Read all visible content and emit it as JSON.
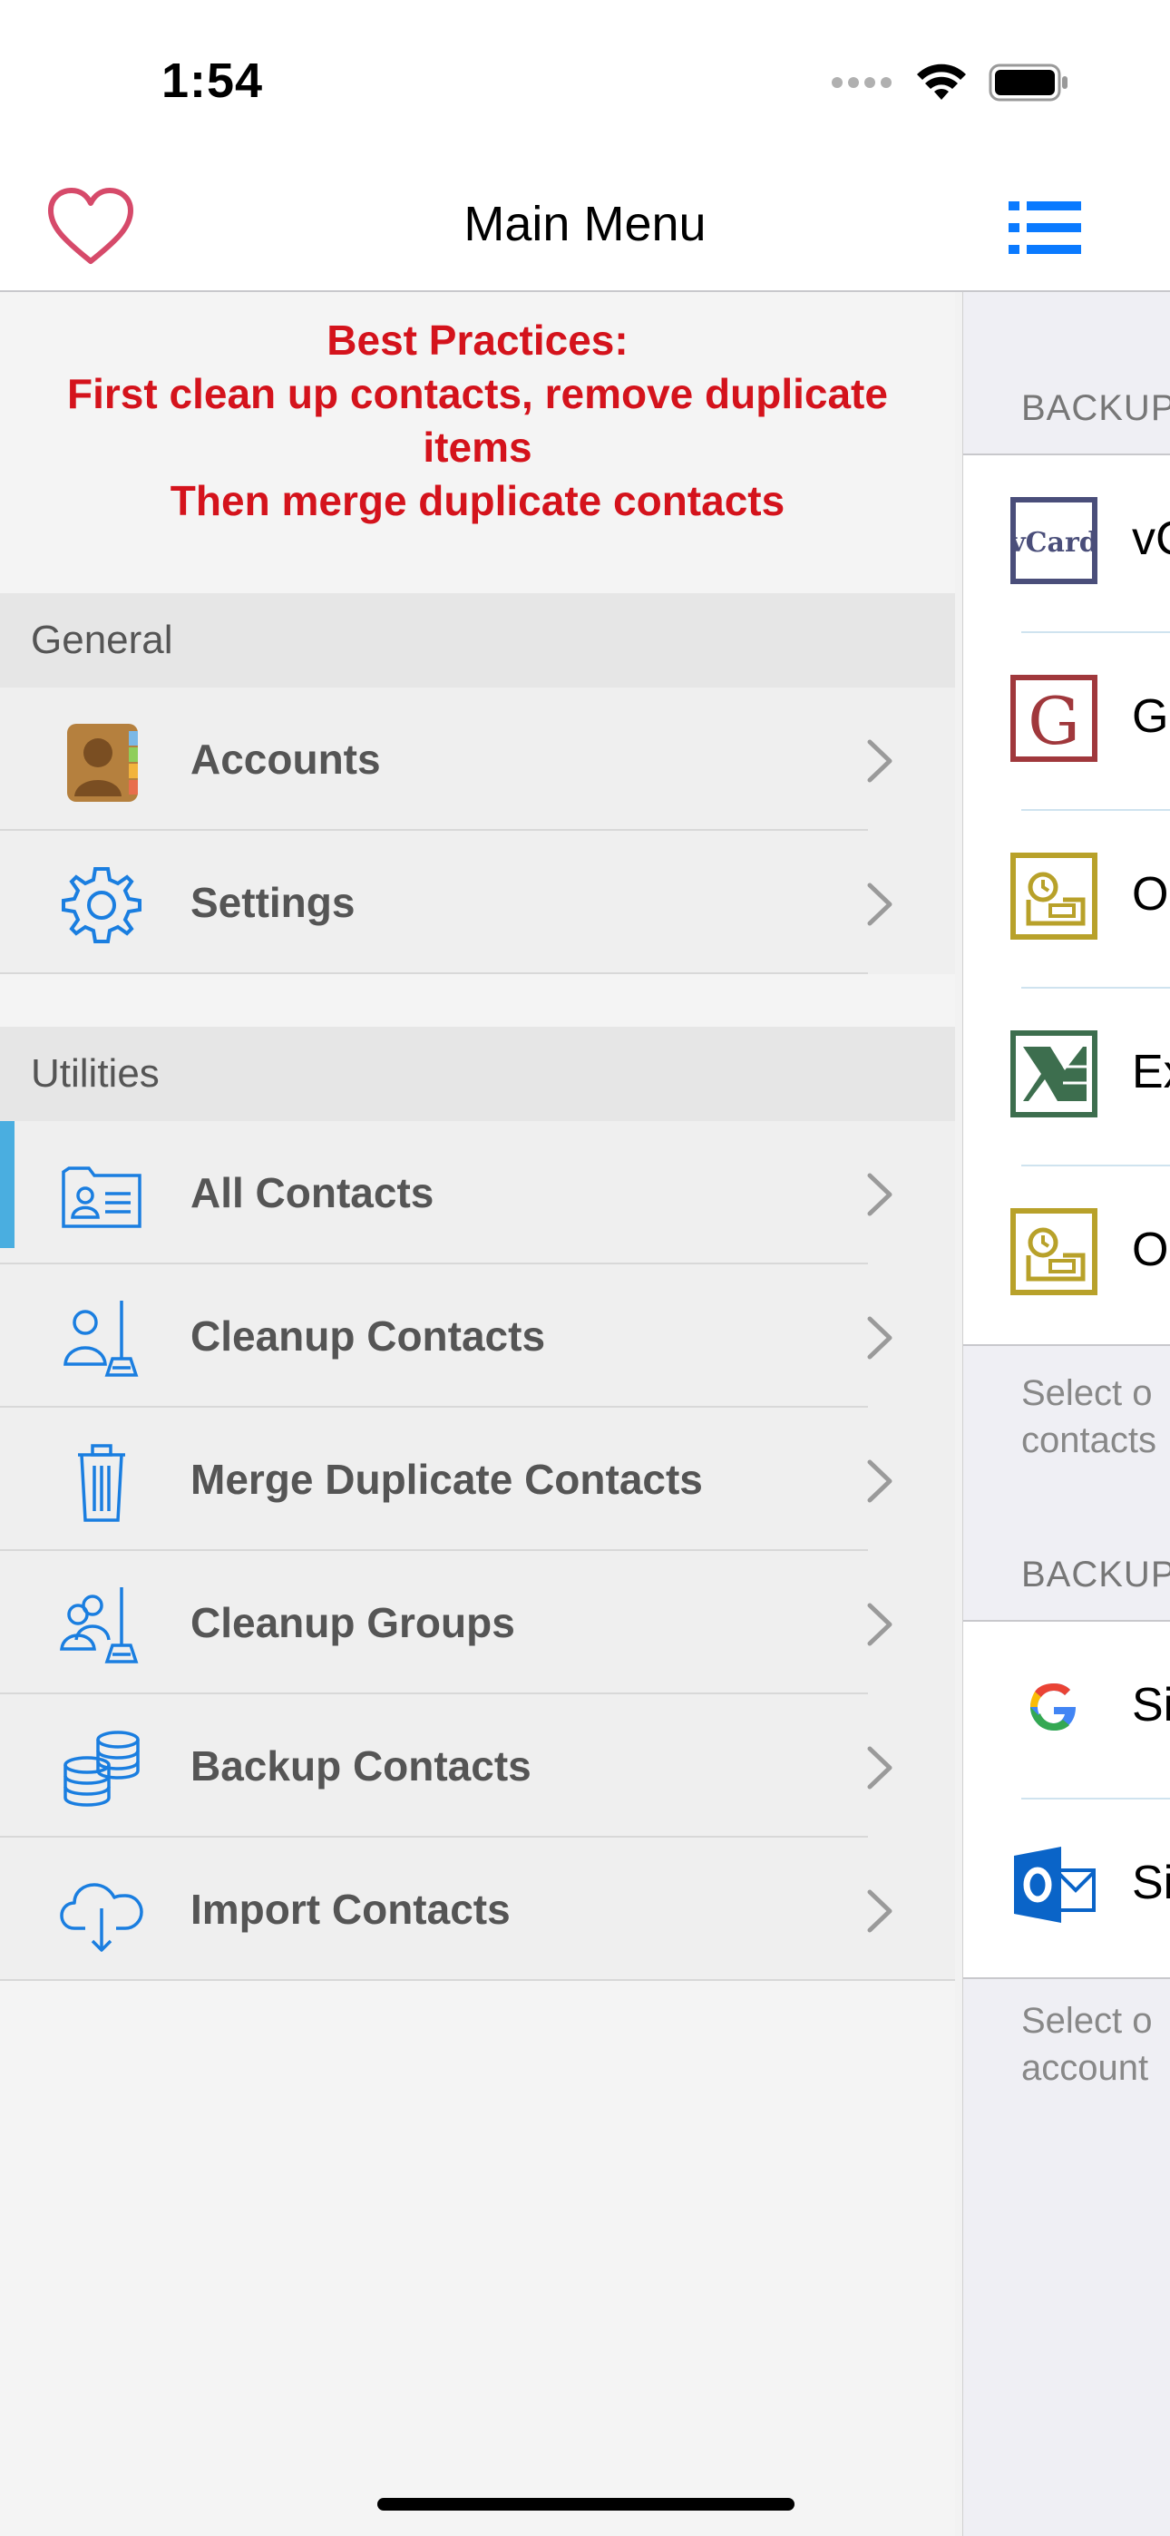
{
  "status_bar": {
    "time": "1:54"
  },
  "nav": {
    "title": "Main Menu",
    "left_icon": "heart-icon",
    "right_icon": "list-icon",
    "accent_color": "#0a7aff",
    "heart_color": "#d64a6a"
  },
  "best_practices": {
    "line1": "Best Practices:",
    "line2": "First clean up contacts, remove duplicate items",
    "line3": "Then merge duplicate contacts",
    "color": "#d4131c"
  },
  "general": {
    "header": "General",
    "items": [
      {
        "label": "Accounts",
        "icon": "contacts-book-icon"
      },
      {
        "label": "Settings",
        "icon": "gear-icon"
      }
    ]
  },
  "utilities": {
    "header": "Utilities",
    "items": [
      {
        "label": "All Contacts",
        "icon": "contact-card-icon"
      },
      {
        "label": "Cleanup Contacts",
        "icon": "cleanup-person-icon"
      },
      {
        "label": "Merge Duplicate Contacts",
        "icon": "trash-icon"
      },
      {
        "label": "Cleanup Groups",
        "icon": "cleanup-group-icon"
      },
      {
        "label": "Backup Contacts",
        "icon": "database-stack-icon"
      },
      {
        "label": "Import Contacts",
        "icon": "cloud-download-icon"
      }
    ]
  },
  "right_panel": {
    "section1_header": "BACKUP",
    "section1_items": [
      {
        "text": "vC",
        "icon": "vcard-icon"
      },
      {
        "text": "G",
        "icon": "gmail-g-icon"
      },
      {
        "text": "O",
        "icon": "outlook-csv-icon"
      },
      {
        "text": "Ex",
        "icon": "excel-icon"
      },
      {
        "text": "O",
        "icon": "outlook-csv-icon"
      }
    ],
    "section1_footer": [
      "Select o",
      "contacts"
    ],
    "section2_header": "BACKUP",
    "section2_items": [
      {
        "text": "Si",
        "icon": "google-icon"
      },
      {
        "text": "Si",
        "icon": "outlook-icon"
      }
    ],
    "section2_footer": [
      "Select o",
      "account"
    ]
  }
}
